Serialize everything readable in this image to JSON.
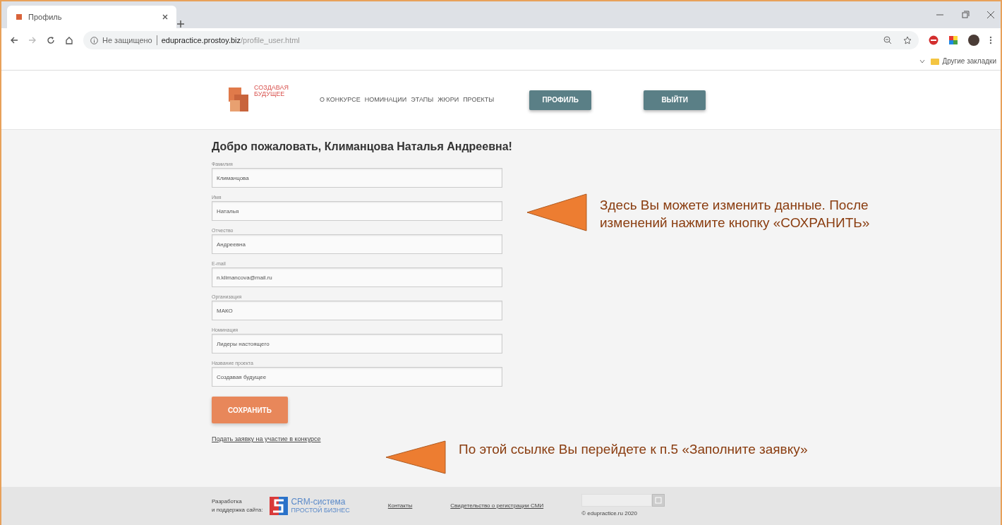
{
  "browser": {
    "tab_title": "Профиль",
    "address_note": "Не защищено",
    "address_host": "edupractice.prostoy.biz",
    "address_path": "/profile_user.html",
    "bookmarks_label": "Другие закладки"
  },
  "site": {
    "logo_line1": "СОЗДАВАЯ",
    "logo_line2": "БУДУЩЕЕ",
    "nav": [
      {
        "label": "О КОНКУРСЕ"
      },
      {
        "label": "НОМИНАЦИИ"
      },
      {
        "label": "ЭТАПЫ"
      },
      {
        "label": "ЖЮРИ"
      },
      {
        "label": "ПРОЕКТЫ"
      }
    ],
    "buttons": [
      {
        "label": "ПРОФИЛЬ"
      },
      {
        "label": "ВЫЙТИ"
      }
    ]
  },
  "form": {
    "greeting": "Добро пожаловать, Климанцова Наталья Андреевна!",
    "fields": [
      {
        "label": "Фамилия",
        "value": "Климанцова"
      },
      {
        "label": "Имя",
        "value": "Наталья"
      },
      {
        "label": "Отчество",
        "value": "Андреевна"
      },
      {
        "label": "E-mail",
        "value": "n.klimancova@mail.ru"
      },
      {
        "label": "Организация",
        "value": "МАКО"
      },
      {
        "label": "Номинация",
        "value": "Лидеры настоящего"
      },
      {
        "label": "Название проекта",
        "value": "Создавая будущее"
      }
    ],
    "save_button": "СОХРАНИТЬ",
    "apply_link": "Подать заявку на участие в конкурсе"
  },
  "annotations": [
    {
      "text": "Здесь Вы можете изменить данные. После изменений нажмите кнопку «СОХРАНИТЬ»"
    },
    {
      "text": "По этой ссылке Вы перейдете к п.5 «Заполните заявку»"
    }
  ],
  "footer": {
    "dev_line1": "Разработка",
    "dev_line2": "и поддержка сайта:",
    "crm_line1": "CRM-система",
    "crm_line2": "ПРОСТОЙ БИЗНЕС",
    "contacts": "Контакты",
    "certificate": "Свидетельство о регистрации СМИ",
    "copyright": "© edupractice.ru 2020"
  }
}
